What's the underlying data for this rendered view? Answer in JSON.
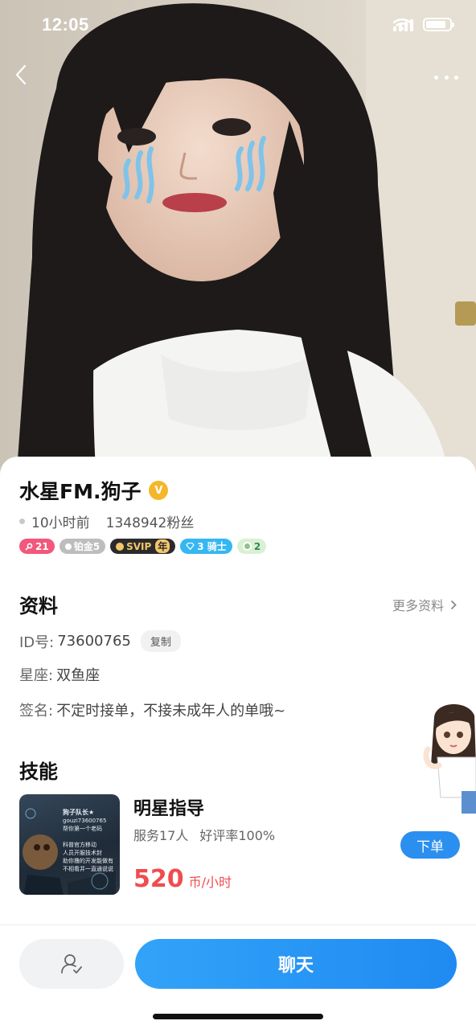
{
  "status_bar": {
    "time": "12:05",
    "battery_level_pct": 85
  },
  "nav": {
    "back_icon": "chevron-left-icon",
    "more_icon": "more-dots-icon"
  },
  "profile": {
    "name": "水星FM.狗子",
    "verified_icon": "verified-v-icon",
    "verified_letter": "V",
    "last_active": "10小时前",
    "fans": "1348942粉丝",
    "badges": {
      "level": "21",
      "platinum": "铂金5",
      "svip": "SVIP",
      "svip_year": "年",
      "knight": "3 骑士",
      "green_level": "2"
    }
  },
  "info_section": {
    "title": "资料",
    "more_label": "更多资料",
    "id_label": "ID号:",
    "id_value": "73600765",
    "copy_label": "复制",
    "constellation_label": "星座:",
    "constellation_value": "双鱼座",
    "signature_label": "签名:",
    "signature_value": "不定时接单，不接未成年人的单哦~"
  },
  "skills_section": {
    "title": "技能",
    "skill": {
      "name": "明星指导",
      "served": "服务17人",
      "rating": "好评率100%",
      "price": "520",
      "price_unit": "币/小时",
      "order_label": "下单",
      "thumb_lines": [
        "狗子队长★",
        "gouzi73600765",
        "帮你第一个老码",
        "",
        "科普官方移动",
        "人员开服技术封",
        "助你撸的开发能做有",
        "不相看并一直通说说"
      ]
    }
  },
  "bottom_bar": {
    "follow_icon": "add-friend-icon",
    "chat_label": "聊天"
  },
  "colors": {
    "accent": "#2b8ff0",
    "price": "#f04c50",
    "verified": "#f5b72a"
  }
}
